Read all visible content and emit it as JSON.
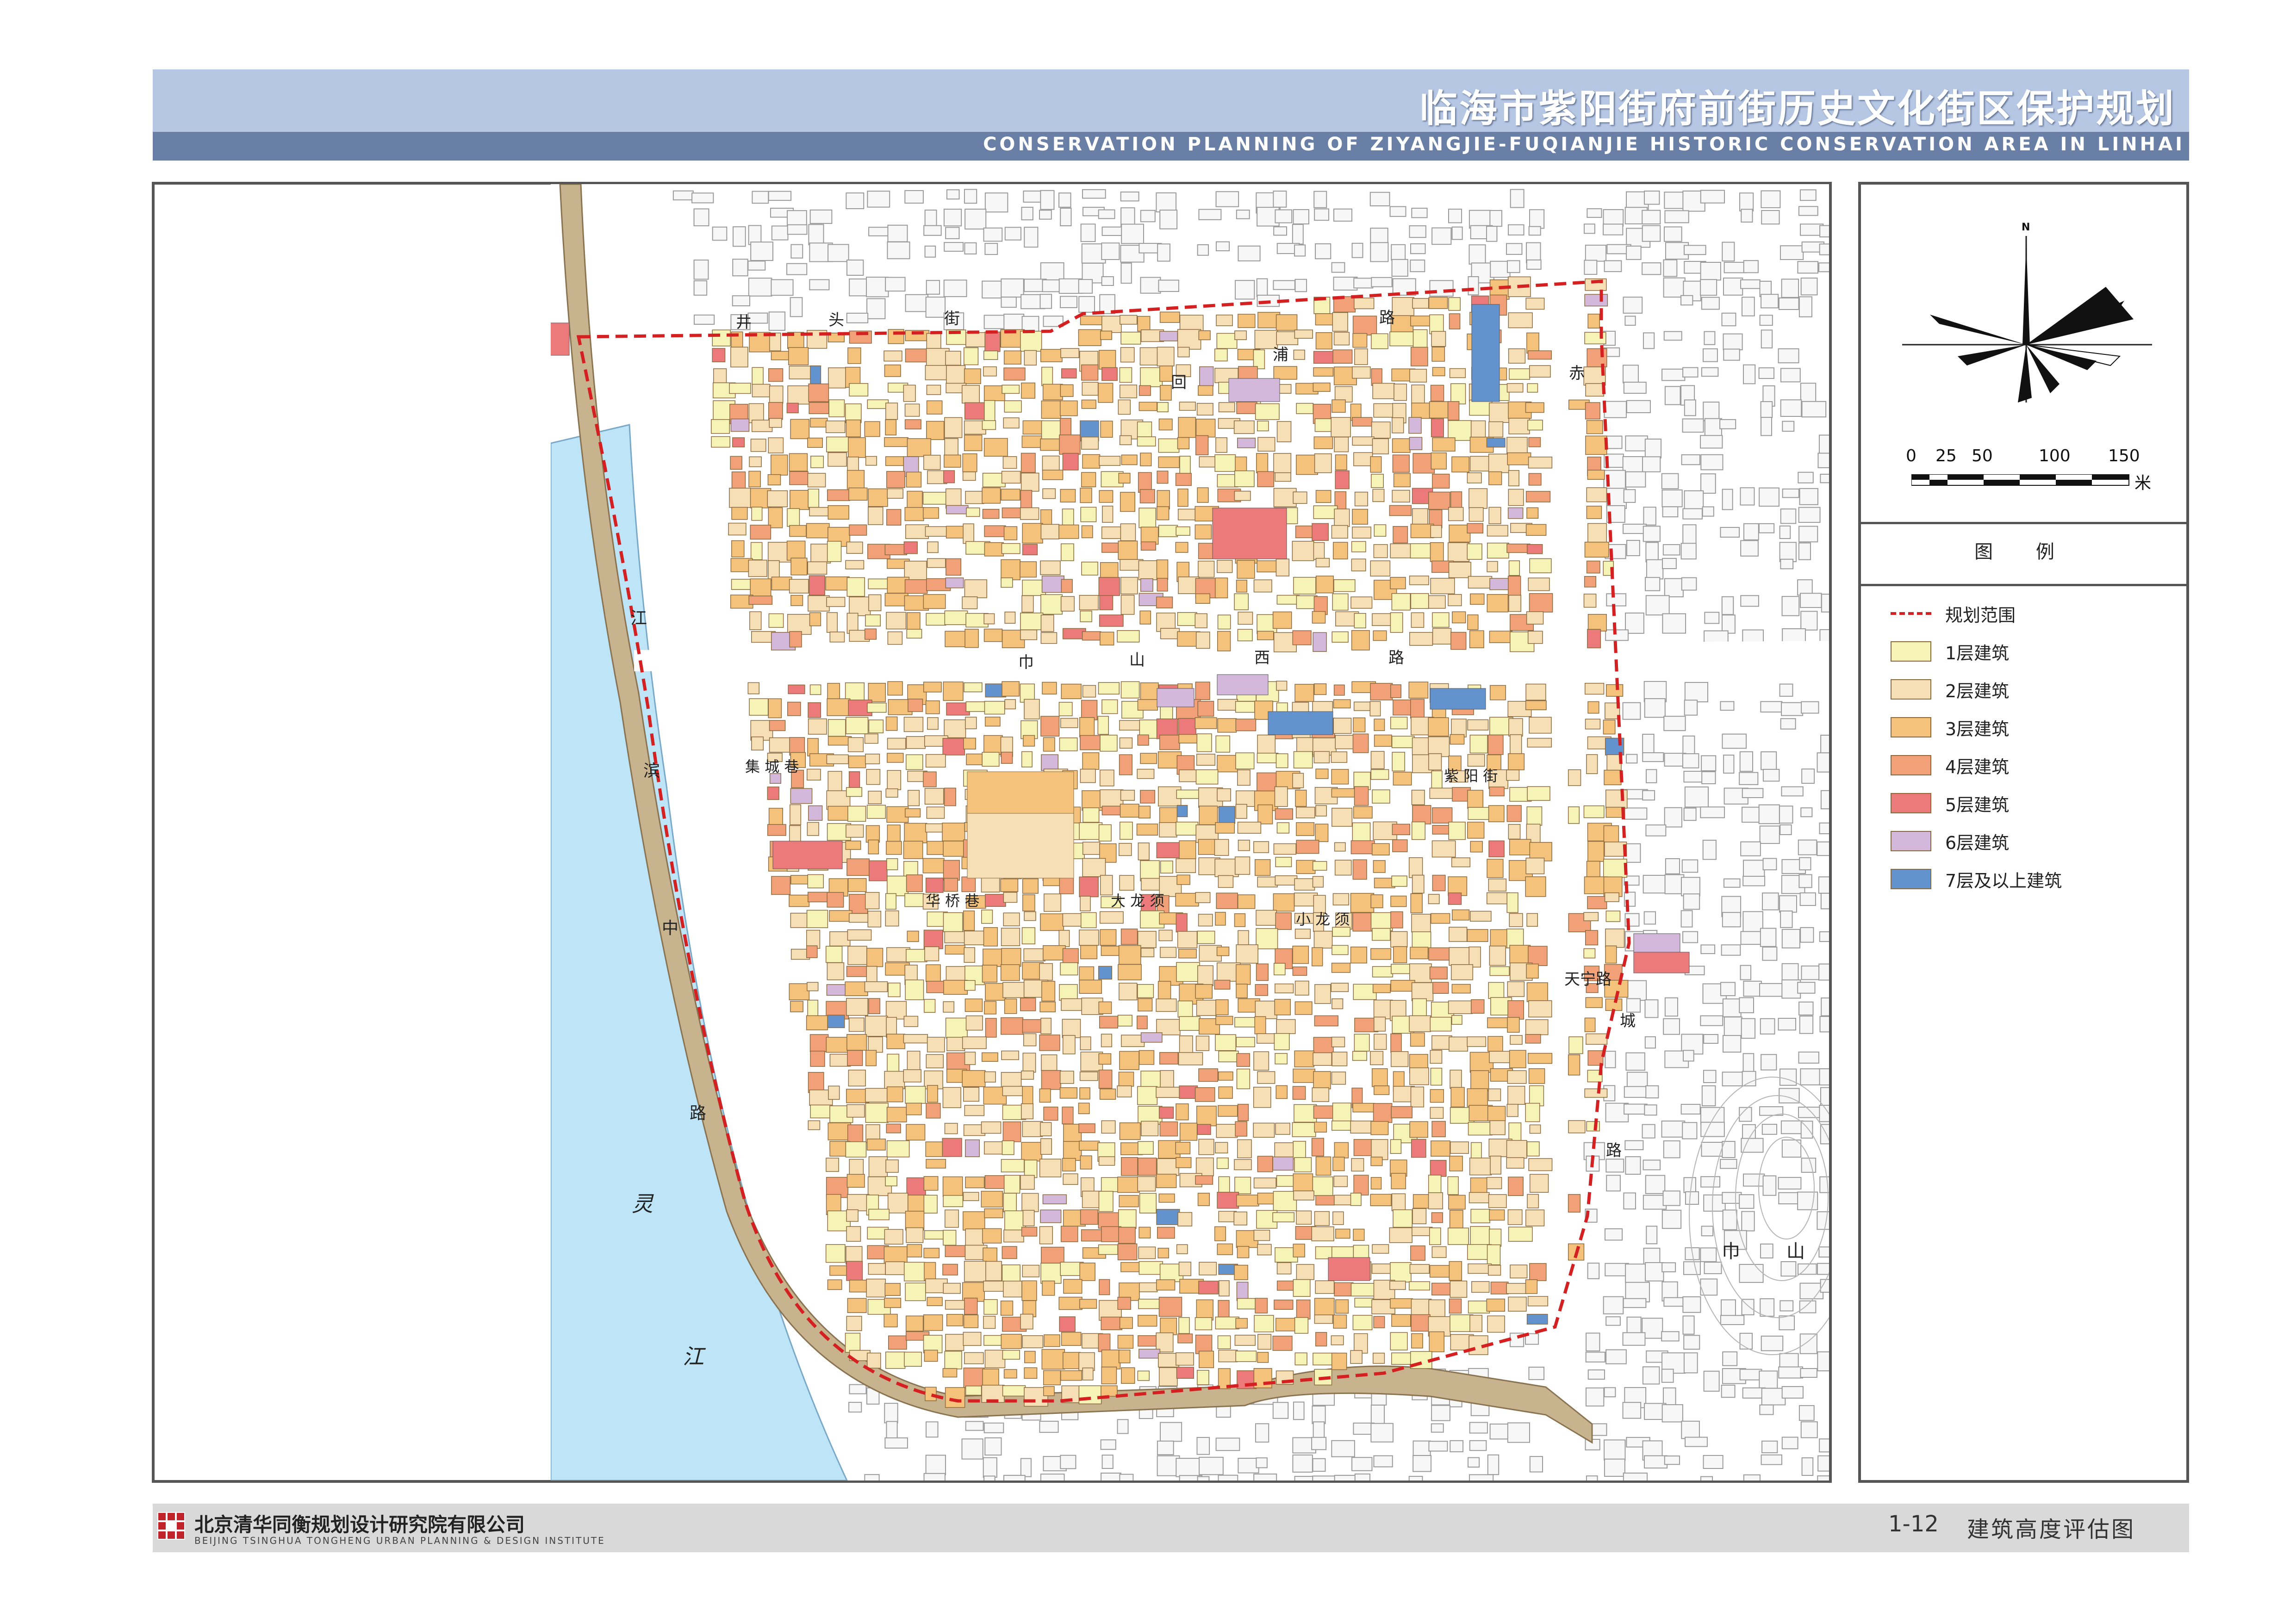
{
  "header": {
    "title_cn": "临海市紫阳街府前街历史文化街区保护规划",
    "title_en": "CONSERVATION PLANNING OF ZIYANGJIE-FUQIANJIE HISTORIC CONSERVATION AREA IN LINHAI"
  },
  "compass": {
    "north_label": "N"
  },
  "scale_bar": {
    "ticks": [
      "0",
      "25",
      "50",
      "100",
      "150"
    ],
    "unit": "米"
  },
  "legend": {
    "title": "图 例",
    "items": [
      {
        "label": "规划范围",
        "type": "boundary",
        "color": "#d42020"
      },
      {
        "label": "1层建筑",
        "type": "fill",
        "color": "#f6f3b6"
      },
      {
        "label": "2层建筑",
        "type": "fill",
        "color": "#f7dfb5"
      },
      {
        "label": "3层建筑",
        "type": "fill",
        "color": "#f4c27a"
      },
      {
        "label": "4层建筑",
        "type": "fill",
        "color": "#f1a078"
      },
      {
        "label": "5层建筑",
        "type": "fill",
        "color": "#ec7a7a"
      },
      {
        "label": "6层建筑",
        "type": "fill",
        "color": "#d4b8dc"
      },
      {
        "label": "7层及以上建筑",
        "type": "fill",
        "color": "#6393ce"
      }
    ]
  },
  "map_labels": {
    "river_1": "灵",
    "river_2": "江",
    "road_jiangbin_1": "江",
    "road_jiangbin_2": "滨",
    "road_jiangbin_3": "中",
    "road_jiangbin_4": "路",
    "road_jingtou_1": "井",
    "road_jingtou_2": "头",
    "road_jingtou_3": "街",
    "road_huipu_1": "回",
    "road_huipu_2": "浦",
    "road_huipu_3": "路",
    "road_jinshan_1": "巾",
    "road_jinshan_2": "山",
    "road_jinshan_3": "西",
    "road_jinshan_4": "路",
    "road_chicheng_1": "赤",
    "road_chicheng_2": "城",
    "road_chicheng_3": "路",
    "road_tianning": "天宁路",
    "hill_1": "巾",
    "hill_2": "山",
    "lane_huaqiao": "华 桥 巷",
    "lane_jicheng": "集 城 巷",
    "lane_ziyang": "紫 阳 街",
    "lane_dalong": "大 龙 须",
    "lane_xiaolong": "小 龙 须"
  },
  "footer": {
    "company_cn": "北京清华同衡规划设计研究院有限公司",
    "company_en": "BEIJING TSINGHUA TONGHENG URBAN PLANNING & DESIGN INSTITUTE",
    "drawing_number": "1-12",
    "drawing_title": "建筑高度评估图"
  }
}
